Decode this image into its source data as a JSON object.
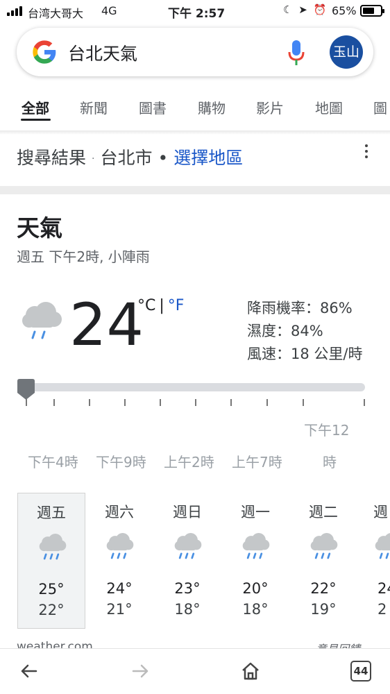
{
  "status_bar": {
    "carrier": "台湾大哥大",
    "network": "4G",
    "time": "下午 2:57",
    "battery_percent": "65%",
    "battery_level": 0.65,
    "icons": [
      "moon-icon",
      "location-arrow-icon",
      "alarm-icon"
    ]
  },
  "search": {
    "query": "台北天氣",
    "avatar_label": "玉山",
    "avatar_color": "#1a4fa0"
  },
  "tabs": [
    "全部",
    "新聞",
    "圖書",
    "購物",
    "影片",
    "地圖",
    "圖"
  ],
  "results": {
    "label": "搜尋結果",
    "dot": "·",
    "location": "台北市",
    "bullet": "•",
    "choose_region": "選擇地區"
  },
  "weather": {
    "title": "天氣",
    "subtitle": "週五 下午2時, 小陣雨",
    "temperature": "24",
    "unit_c": "°C",
    "unit_sep": "|",
    "unit_f": "°F",
    "precip": "降雨機率：86%",
    "humidity": "濕度：84%",
    "wind": "風速：18 公里/時",
    "slider_position": 0,
    "time_labels": [
      "下午4時",
      "下午9時",
      "上午2時",
      "上午7時",
      "下午12",
      "時"
    ],
    "days": [
      {
        "name": "週五",
        "high": "25°",
        "low": "22°",
        "selected": true
      },
      {
        "name": "週六",
        "high": "24°",
        "low": "21°"
      },
      {
        "name": "週日",
        "high": "23°",
        "low": "18°"
      },
      {
        "name": "週一",
        "high": "20°",
        "low": "18°"
      },
      {
        "name": "週二",
        "high": "22°",
        "low": "19°"
      },
      {
        "name": "週",
        "high": "24",
        "low": "2"
      }
    ],
    "source": "weather.com",
    "feedback": "意見回饋"
  },
  "bottom_bar": {
    "tab_count": "44"
  }
}
